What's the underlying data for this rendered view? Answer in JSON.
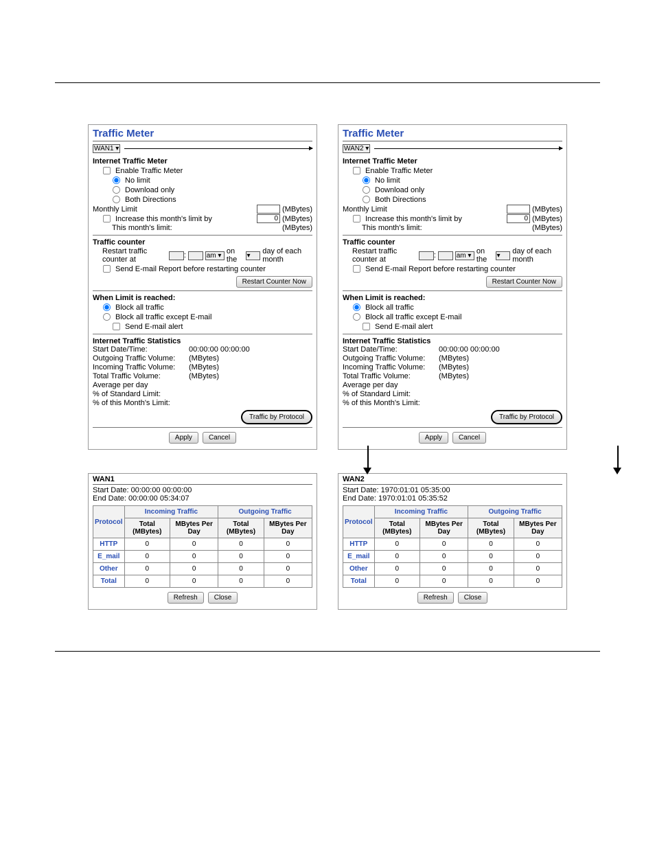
{
  "panels": [
    {
      "wan": "WAN1",
      "heading": "Traffic Meter",
      "sections": {
        "meter_title": "Internet Traffic Meter",
        "enable": "Enable Traffic Meter",
        "nolimit": "No limit",
        "download": "Download only",
        "both": "Both Directions",
        "monthly": "Monthly Limit",
        "unit": "(MBytes)",
        "increase": "Increase this month's limit by",
        "increase_val": "0",
        "thismonth": "This month's limit:"
      },
      "counter": {
        "title": "Traffic counter",
        "restart_pre": "Restart traffic counter at",
        "ampm": "am",
        "onthe": "on the",
        "suffix": "day of each month",
        "sendreport": "Send E-mail Report before restarting counter",
        "restart_btn": "Restart Counter Now"
      },
      "limit": {
        "title": "When Limit is reached:",
        "blockall": "Block all traffic",
        "blockexcept": "Block all traffic except E-mail",
        "sendalert": "Send E-mail alert"
      },
      "stats": {
        "title": "Internet Traffic Statistics",
        "start": "Start Date/Time:",
        "start_val": "00:00:00 00:00:00",
        "out": "Outgoing Traffic Volume:",
        "out_val": "(MBytes)",
        "in": "Incoming Traffic Volume:",
        "in_val": "(MBytes)",
        "total": "Total Traffic Volume:",
        "total_val": "(MBytes)",
        "avg": "Average per day",
        "std": "% of Standard Limit:",
        "mon": "% of this Month's Limit:",
        "proto_btn": "Traffic by Protocol"
      },
      "apply": "Apply",
      "cancel": "Cancel",
      "proto": {
        "wan": "WAN1",
        "start": "Start Date: 00:00:00 00:00:00",
        "end": "End Date:   00:00:00 05:34:07"
      }
    },
    {
      "wan": "WAN2",
      "heading": "Traffic Meter",
      "sections": {
        "meter_title": "Internet Traffic Meter",
        "enable": "Enable Traffic Meter",
        "nolimit": "No limit",
        "download": "Download only",
        "both": "Both Directions",
        "monthly": "Monthly Limit",
        "unit": "(MBytes)",
        "increase": "Increase this month's limit by",
        "increase_val": "0",
        "thismonth": "This month's limit:"
      },
      "counter": {
        "title": "Traffic counter",
        "restart_pre": "Restart traffic counter at",
        "ampm": "am",
        "onthe": "on the",
        "suffix": "day of each month",
        "sendreport": "Send E-mail Report before restarting counter",
        "restart_btn": "Restart Counter Now"
      },
      "limit": {
        "title": "When Limit is reached:",
        "blockall": "Block all traffic",
        "blockexcept": "Block all traffic except E-mail",
        "sendalert": "Send E-mail alert"
      },
      "stats": {
        "title": "Internet Traffic Statistics",
        "start": "Start Date/Time:",
        "start_val": "00:00:00 00:00:00",
        "out": "Outgoing Traffic Volume:",
        "out_val": "(MBytes)",
        "in": "Incoming Traffic Volume:",
        "in_val": "(MBytes)",
        "total": "Total Traffic Volume:",
        "total_val": "(MBytes)",
        "avg": "Average per day",
        "std": "% of Standard Limit:",
        "mon": "% of this Month's Limit:",
        "proto_btn": "Traffic by Protocol"
      },
      "apply": "Apply",
      "cancel": "Cancel",
      "proto": {
        "wan": "WAN2",
        "start": "Start Date: 1970:01:01 05:35:00",
        "end": "End Date:   1970:01:01 05:35:52"
      }
    }
  ],
  "table": {
    "hdr_protocol": "Protocol",
    "hdr_incoming": "Incoming Traffic",
    "hdr_outgoing": "Outgoing Traffic",
    "sub_total": "Total (MBytes)",
    "sub_perday": "MBytes Per Day",
    "rows": [
      "HTTP",
      "E_mail",
      "Other",
      "Total"
    ],
    "zero": "0",
    "refresh": "Refresh",
    "close": "Close"
  }
}
